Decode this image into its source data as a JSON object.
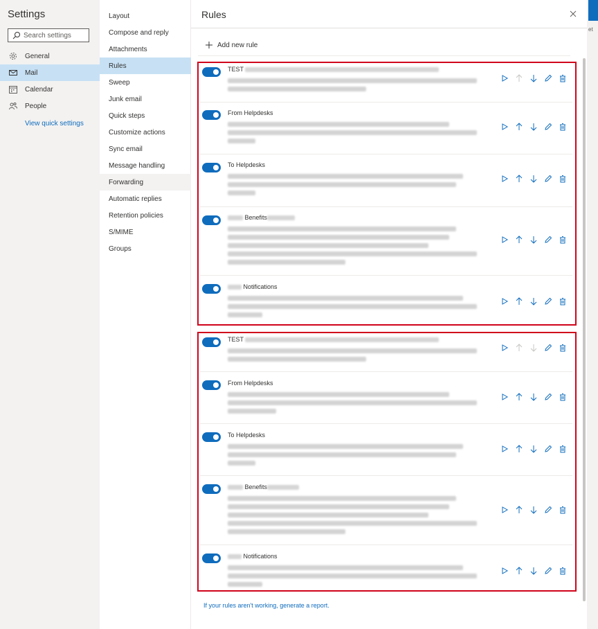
{
  "left_nav": {
    "title": "Settings",
    "search_placeholder": "Search settings",
    "items": [
      {
        "label": "General",
        "icon": "gear-icon"
      },
      {
        "label": "Mail",
        "icon": "mail-icon"
      },
      {
        "label": "Calendar",
        "icon": "calendar-icon"
      },
      {
        "label": "People",
        "icon": "people-icon"
      }
    ],
    "quick_link": "View quick settings"
  },
  "sub_nav": {
    "items": [
      "Layout",
      "Compose and reply",
      "Attachments",
      "Rules",
      "Sweep",
      "Junk email",
      "Quick steps",
      "Customize actions",
      "Sync email",
      "Message handling",
      "Forwarding",
      "Automatic replies",
      "Retention policies",
      "S/MIME",
      "Groups"
    ],
    "selected": "Rules"
  },
  "main": {
    "title": "Rules",
    "add_rule_label": "Add new rule",
    "footer_link": "If your rules aren't working, generate a report.",
    "groups": [
      {
        "rules": [
          {
            "name": "TEST"
          },
          {
            "name": "From Helpdesks"
          },
          {
            "name": "To Helpdesks"
          },
          {
            "name": "Benefits"
          },
          {
            "name": "Notifications"
          }
        ]
      },
      {
        "rules": [
          {
            "name": "TEST"
          },
          {
            "name": "From Helpdesks"
          },
          {
            "name": "To Helpdesks"
          },
          {
            "name": "Benefits"
          },
          {
            "name": "Notifications"
          }
        ]
      }
    ]
  },
  "colors": {
    "accent": "#0f6cbd",
    "selected": "#c7e0f4",
    "highlight_border": "#d0021b"
  },
  "corner_text": "et"
}
